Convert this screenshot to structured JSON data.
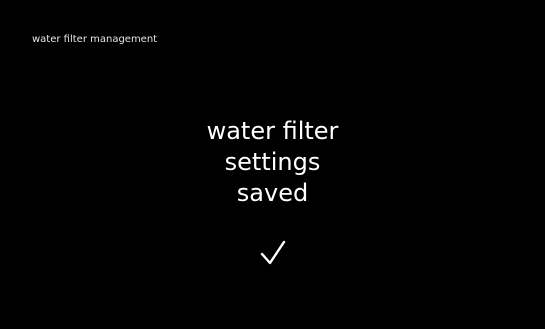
{
  "header": {
    "title": "water filter management"
  },
  "message": {
    "lines": [
      "water filter",
      "settings",
      "saved"
    ]
  },
  "status_icon": "check-icon",
  "colors": {
    "background": "#000000",
    "text": "#ffffff"
  }
}
